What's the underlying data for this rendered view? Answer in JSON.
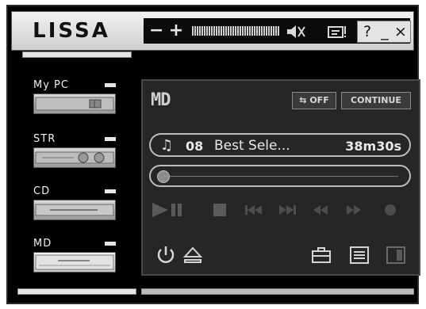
{
  "app": {
    "logo": "LISSA"
  },
  "topbar": {
    "vol_minus": "−",
    "vol_plus": "+",
    "icons": [
      "volume-meter-icon",
      "mute-icon",
      "display-icon"
    ],
    "help": "?",
    "minimize": "_",
    "close": "×"
  },
  "sources": [
    {
      "label": "My PC"
    },
    {
      "label": "STR"
    },
    {
      "label": "CD"
    },
    {
      "label": "MD"
    }
  ],
  "md": {
    "title": "MD",
    "repeat_label": "OFF",
    "continue_label": "CONTINUE",
    "track_number": "08",
    "track_title": "Best Sele...",
    "time": "38m30s",
    "controls": [
      "play-pause-icon",
      "stop-icon",
      "prev-track-icon",
      "next-track-icon",
      "rewind-icon",
      "fast-forward-icon",
      "record-icon"
    ],
    "bottom_left": [
      "power-icon",
      "eject-icon"
    ],
    "bottom_right": [
      "toolbox-icon",
      "list-icon",
      "panel-icon"
    ]
  },
  "colors": {
    "panel": "#262626",
    "frame": "#000000",
    "accent": "#e6e6e6"
  }
}
